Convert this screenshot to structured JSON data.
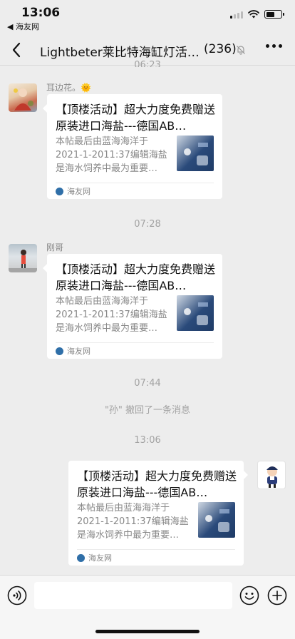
{
  "status_bar": {
    "time": "13:06",
    "back_label": "◀ 海友网"
  },
  "nav": {
    "title": "Lightbeter莱比特海缸灯活…",
    "count": "(236)"
  },
  "chat": {
    "partial_time": "06:23",
    "messages": [
      {
        "sender": "耳边花。🌞",
        "card": {
          "title": "【顶楼活动】超大力度免费赠送原装进口海盐---德国AB…",
          "desc": "本帖最后由蓝海海洋于2021-1-2011:37编辑海盐是海水饲养中最为重要…",
          "source": "海友网"
        }
      },
      {
        "time": "07:28",
        "sender": "刚哥",
        "card": {
          "title": "【顶楼活动】超大力度免费赠送原装进口海盐---德国AB…",
          "desc": "本帖最后由蓝海海洋于2021-1-2011:37编辑海盐是海水饲养中最为重要…",
          "source": "海友网"
        }
      },
      {
        "time": "07:44",
        "system": "\"孙\" 撤回了一条消息"
      },
      {
        "time": "13:06",
        "card": {
          "title": "【顶楼活动】超大力度免费赠送原装进口海盐---德国AB…",
          "desc": "本帖最后由蓝海海洋于2021-1-2011:37编辑海盐是海水饲养中最为重要…",
          "source": "海友网"
        }
      }
    ]
  },
  "icons": {
    "back": "chevron-left-icon",
    "mute": "bell-off-icon",
    "more": "more-dots-icon",
    "voice": "voice-icon",
    "emoji": "emoji-icon",
    "plus": "plus-icon"
  }
}
